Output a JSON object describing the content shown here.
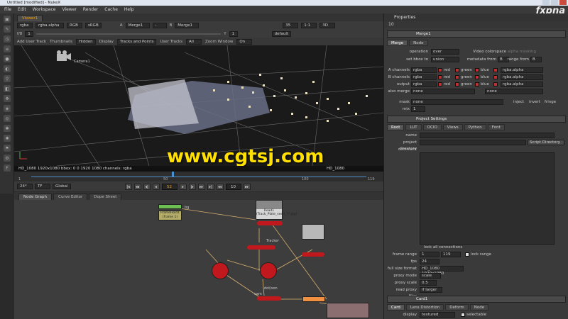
{
  "window": {
    "title": "Untitled [modified] - NukeX"
  },
  "menu": [
    "File",
    "Edit",
    "Workspace",
    "Viewer",
    "Render",
    "Cache",
    "Help"
  ],
  "watermark_logo": "fxpna",
  "viewer": {
    "tab": "Viewer1",
    "bar1": {
      "channels": "rgba",
      "layer": "rgba.alpha",
      "colorspace_a": "RGB",
      "colorspace_b": "sRGB",
      "a_label": "A",
      "a_input": "Merge1",
      "op": "-",
      "b_label": "B",
      "b_input": "Merge1",
      "zoom": "35",
      "ratio": "1:1",
      "view_mode": "3D"
    },
    "bar2": {
      "frame_label": "f/8",
      "frame_val": "1",
      "y_label": "Y",
      "y_val": "1",
      "lut": "default"
    },
    "bar3": {
      "add_user_track": "Add User Track",
      "thumbnails_label": "Thumbnails",
      "thumbnails_val": "Hidden",
      "display_label": "Display",
      "display_val": "Tracks and Points",
      "user_tracks_label": "User Tracks",
      "user_tracks_val": "All",
      "zoom_window_label": "Zoom Window",
      "zoom_window_val": "On"
    },
    "camera_label": "Camera1",
    "info": "HD_1080 1920x1080  bbox: 0 0 1920 1080 channels: rgba",
    "info_right": "HD_1080",
    "watermark": "www.cgtsj.com"
  },
  "timeline": {
    "marks": [
      "1",
      "50",
      "100",
      "119"
    ],
    "fps_val": "24*",
    "tf_val": "TF",
    "global_val": "Global",
    "frame": "52",
    "step": "10",
    "ticks_left": "1",
    "ticks_right": "119"
  },
  "nodegraph": {
    "tabs": [
      "Node Graph",
      "Curve Editor",
      "Dope Sheet"
    ],
    "nodes": {
      "framehold": "FrameHold1",
      "framehold_sub": "(frame 1)",
      "bg": "bg",
      "read": "Read1",
      "read_sub": "(Track_Plate_seed_??.jpg)",
      "tracker": "Tracker",
      "card": "Card",
      "dot_label": "dot/son",
      "cam": "cam"
    }
  },
  "properties": {
    "title": "Properties",
    "count": "10",
    "merge": {
      "name": "Merge1",
      "tabs": [
        "Merge",
        "Node"
      ],
      "operation_k": "operation",
      "operation_v": "over",
      "video_cs": "Video colorspace",
      "alpha_masking": "alpha masking",
      "setbbox_k": "set bbox to",
      "setbbox_v": "union",
      "metadata_k": "metadata from",
      "metadata_v": "B",
      "range_k": "range from",
      "range_v": "B",
      "a_ch_k": "A channels",
      "a_ch_v": "rgba",
      "b_ch_k": "B channels",
      "b_ch_v": "rgba",
      "out_k": "output",
      "out_v": "rgba",
      "also_k": "also merge",
      "also_v": "none",
      "also_v2": "none",
      "red": "red",
      "green": "green",
      "blue": "blue",
      "alpha": "rgba.alpha",
      "mask_k": "mask",
      "mask_v": "none",
      "inject": "inject",
      "invert": "invert",
      "fringe": "fringe",
      "mix_k": "mix",
      "mix_v": "1"
    },
    "project": {
      "name": "Project Settings",
      "tabs": [
        "Root",
        "LUT",
        "OCIO",
        "Views",
        "Python",
        "Font"
      ],
      "name_k": "name",
      "dir_k": "project directory",
      "script_dir": "Script Directory",
      "comment_k": "comment",
      "lock": "lock all connections",
      "frame_range_k": "frame range",
      "frame_start": "1",
      "frame_end": "119",
      "lock_range": "lock range",
      "fps_k": "fps",
      "fps_v": "24",
      "format_k": "full size format",
      "format_v": "HD_1080 1920x1080",
      "proxy_mode_k": "proxy mode",
      "proxy_mode_v": "scale",
      "proxy_scale_k": "proxy scale",
      "proxy_scale_v": "0.5",
      "read_proxy_k": "read proxy files",
      "read_proxy_v": "if larger"
    },
    "card": {
      "name": "Card1",
      "tabs": [
        "Card",
        "Lens Distortion",
        "Deform",
        "Node"
      ],
      "display_k": "display",
      "display_v": "textured",
      "selectable": "selectable"
    }
  },
  "colors": {
    "accent": "#f0a000",
    "node_red": "#c0181c",
    "watermark": "#ffe000"
  }
}
